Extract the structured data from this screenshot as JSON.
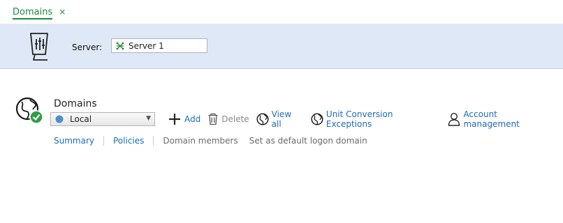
{
  "tab": {
    "label": "Domains",
    "close_glyph": "×"
  },
  "server": {
    "label": "Server:",
    "selected": "Server 1",
    "icon": "server-config-icon"
  },
  "domains": {
    "title": "Domains",
    "selected": "Local",
    "toolbar": [
      {
        "name": "add",
        "label": "Add",
        "icon": "plus-icon",
        "enabled": true
      },
      {
        "name": "delete",
        "label": "Delete",
        "icon": "trash-icon",
        "enabled": false
      },
      {
        "name": "view-all",
        "label": "View all",
        "icon": "globe-icon",
        "enabled": true
      },
      {
        "name": "unit-conversion-exceptions",
        "label": "Unit Conversion Exceptions",
        "icon": "globe-icon",
        "enabled": true
      },
      {
        "name": "account-management",
        "label": "Account management",
        "icon": "user-icon",
        "enabled": true
      }
    ],
    "subnav": {
      "summary": "Summary",
      "policies": "Policies",
      "domain_members": "Domain members",
      "set_default": "Set as default logon domain"
    }
  },
  "colors": {
    "accent_green": "#1e8a3a",
    "link_blue": "#1c6bb8",
    "band": "#dfe8f6"
  }
}
